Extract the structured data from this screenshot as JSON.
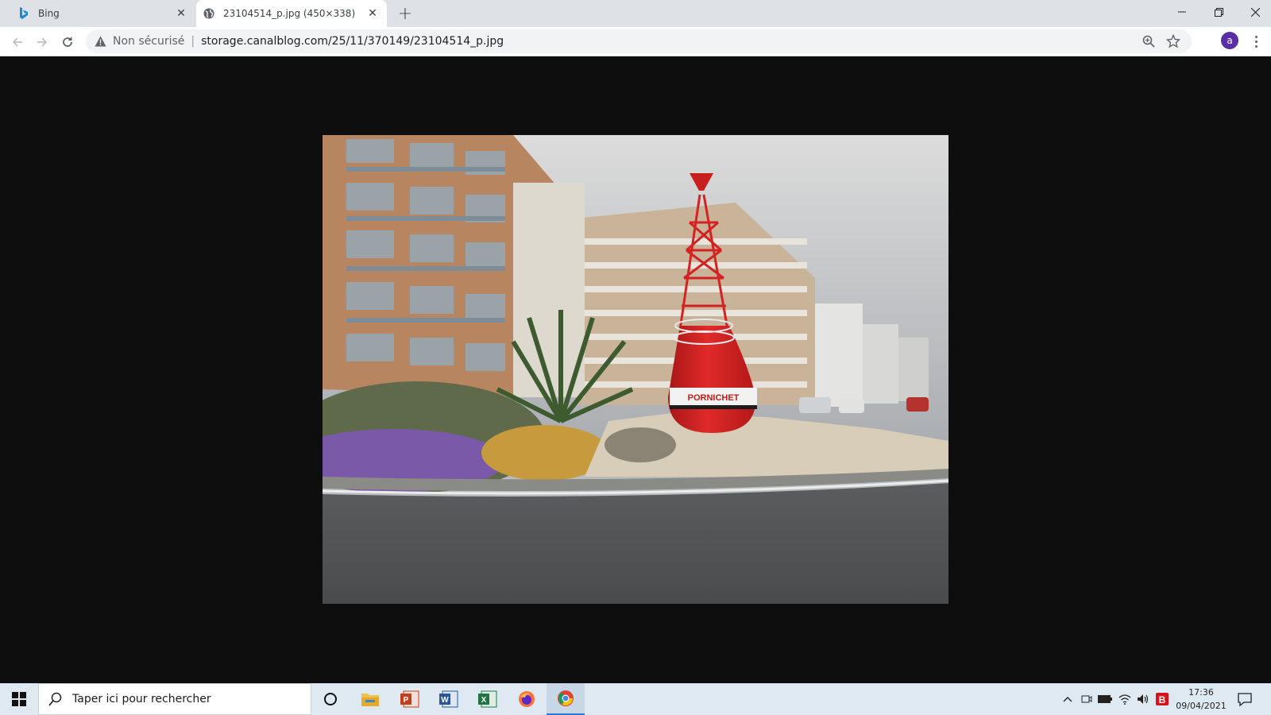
{
  "browser": {
    "tabs": [
      {
        "title": "Bing",
        "favicon": "bing-icon",
        "active": false
      },
      {
        "title": "23104514_p.jpg (450×338)",
        "favicon": "globe-icon",
        "active": true
      }
    ],
    "security_label": "Non sécurisé",
    "url": "storage.canalblog.com/25/11/370149/23104514_p.jpg",
    "profile_initial": "a"
  },
  "image": {
    "description_text": "PORNICHET",
    "type": "jpg photo"
  },
  "taskbar": {
    "search_placeholder": "Taper ici pour rechercher",
    "apps": [
      "task-view-icon",
      "file-explorer-icon",
      "powerpoint-icon",
      "word-icon",
      "excel-icon",
      "firefox-icon",
      "chrome-icon"
    ],
    "time": "17:36",
    "date": "09/04/2021",
    "colors": {
      "accent": "#2e7bd1"
    }
  }
}
